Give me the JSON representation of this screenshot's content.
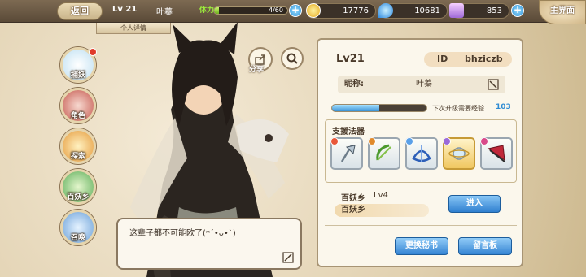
{
  "topbar": {
    "back_label": "返回",
    "level": "Lv 21",
    "name": "叶蓁",
    "stamina_label": "体力",
    "stamina_text": "4/60",
    "stamina_fraction": 0.067,
    "gold": "17776",
    "gems": "10681",
    "tickets": "853",
    "home_label": "主界面",
    "detail_tab": "个人详情"
  },
  "menu": {
    "items": [
      {
        "label": "捕妖",
        "icon": "cat-spirit-icon"
      },
      {
        "label": "角色",
        "icon": "character-portrait-icon"
      },
      {
        "label": "探索",
        "icon": "explore-icon"
      },
      {
        "label": "百妖乡",
        "icon": "village-icon"
      },
      {
        "label": "召唤",
        "icon": "summon-icon"
      }
    ]
  },
  "share_label": "分享",
  "dialogue": {
    "text": "这辈子都不可能欧了(*ˊ•ᴗ•ˋ)"
  },
  "profile": {
    "level": "Lv21",
    "id_label": "ID",
    "id_value": "bhziczb",
    "nick_label": "昵称:",
    "nick_value": "叶蓁",
    "exp_fraction": 0.5,
    "exp_label": "下次升级需要经验",
    "exp_value": "103",
    "support_title": "支援法器",
    "support_items": [
      {
        "icon": "axe-icon",
        "gem": "#e9583a"
      },
      {
        "icon": "green-bow-icon",
        "gem": "#e08a2b"
      },
      {
        "icon": "blue-ribbon-icon",
        "gem": "#5aa0e8"
      },
      {
        "icon": "orb-icon",
        "gem": "#9b6ad8",
        "selected": true
      },
      {
        "icon": "red-fan-icon",
        "gem": "#d94a8a"
      }
    ],
    "village_name": "百妖乡",
    "village_level": "Lv4",
    "village_bar": "百妖乡",
    "enter_label": "进入",
    "change_label": "更换秘书",
    "board_label": "留言板"
  },
  "colors": {
    "accent_blue": "#3584d3",
    "panel_bg": "#fbf7ec",
    "border_brown": "#a79474"
  }
}
